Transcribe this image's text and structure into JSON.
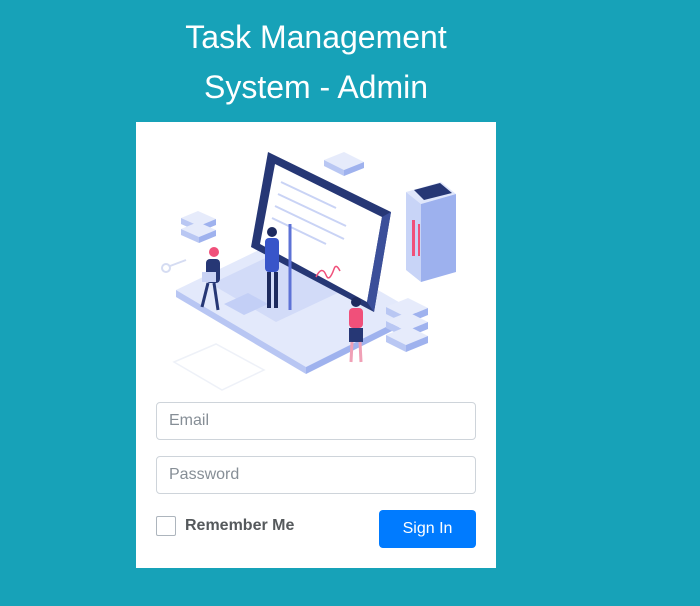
{
  "header": {
    "title_line1": "Task Management",
    "title_line2": "System - Admin"
  },
  "login_form": {
    "email_placeholder": "Email",
    "email_value": "",
    "password_placeholder": "Password",
    "password_value": "",
    "remember_label": "Remember Me",
    "remember_checked": false,
    "signin_label": "Sign In"
  },
  "illustration": {
    "icon": "workspace-illustration"
  },
  "colors": {
    "background": "#17a2b8",
    "card": "#ffffff",
    "primary_button": "#007bff",
    "illustration_navy": "#2a3a7c",
    "illustration_blue": "#8fa6ee",
    "illustration_light": "#e8edfb",
    "illustration_pink": "#f0507a"
  }
}
